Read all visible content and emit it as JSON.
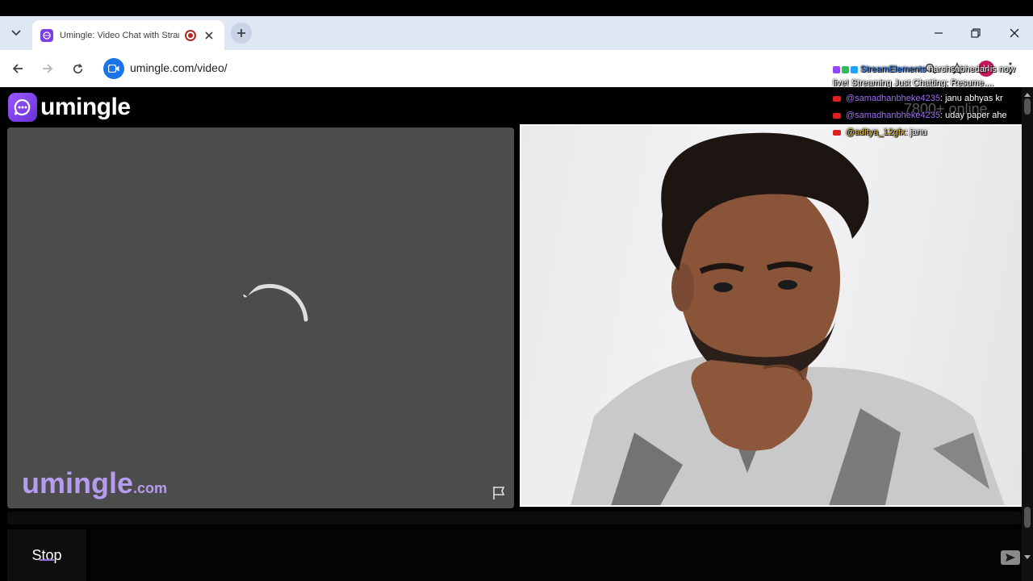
{
  "browser": {
    "tab": {
      "title": "Umingle: Video Chat with Strangers"
    },
    "new_tab_label": "+",
    "address": {
      "url": "umingle.com/video/"
    },
    "profile_initial": "H"
  },
  "site": {
    "logo_text": "umingle",
    "watermark_main": "umingle",
    "watermark_tld": ".com",
    "online_count": "7800+ online",
    "stop_label": "Stop",
    "chat_placeholder": ""
  },
  "overlay": {
    "announcer": "StreamElements",
    "announcement": "harshsubhedar is now live! Streaming Just Chatting: Resume....",
    "messages": [
      {
        "user": "@samadhanbheke4235",
        "text": ": janu abhyas kr"
      },
      {
        "user": "@samadhanbheke4235",
        "text": ": uday paper ahe"
      },
      {
        "user": "@aditya_12gfx",
        "text": ": janu"
      }
    ]
  },
  "colors": {
    "brand": "#7b3fe4",
    "watermark": "#b69cf0",
    "tabstrip": "#dfe6f4",
    "video_bg": "#4c4c4c"
  },
  "icons": [
    "tab-search-icon",
    "umingle-favicon",
    "recording-icon",
    "close-icon",
    "plus-icon",
    "minimize-icon",
    "restore-icon",
    "back-icon",
    "forward-icon",
    "reload-icon",
    "video-site-icon",
    "zoom-icon",
    "star-icon",
    "more-icon",
    "chat-bubble-icon",
    "spinner-icon",
    "flag-icon",
    "send-icon"
  ]
}
